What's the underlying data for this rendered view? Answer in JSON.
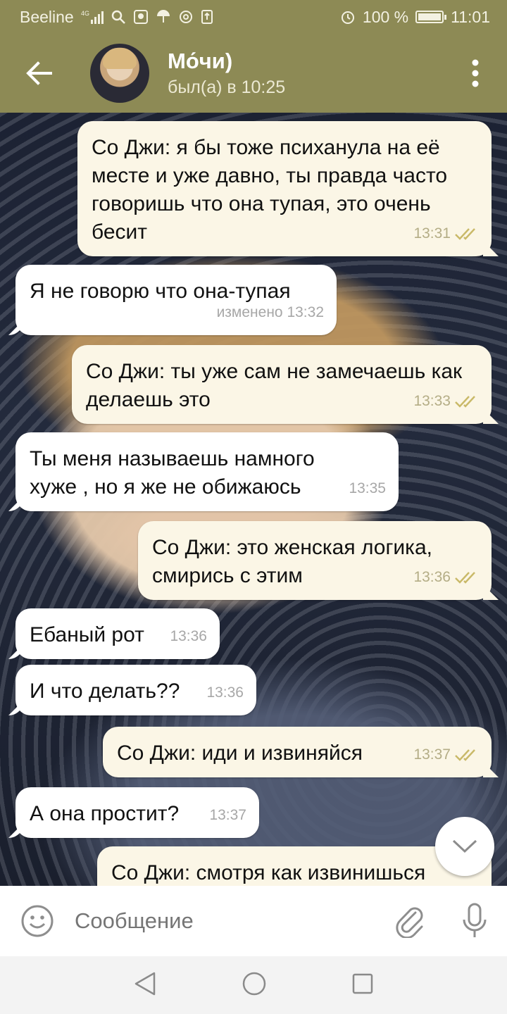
{
  "status_bar": {
    "carrier": "Beeline",
    "network": "4G",
    "battery": "100 %",
    "battery_level": 1.0,
    "time": "11:01"
  },
  "header": {
    "name": "Мо́чи)",
    "status": "был(а) в 10:25"
  },
  "messages": [
    {
      "direction": "out",
      "text": "Со Джи: я бы тоже психанула на её месте и уже давно, ты правда часто говоришь что она тупая, это очень бесит",
      "time": "13:31",
      "status": "read"
    },
    {
      "direction": "in",
      "text": "Я не говорю что она-тупая",
      "time": "изменено 13:32"
    },
    {
      "direction": "out",
      "text": "Со Джи: ты уже сам не замечаешь как делаешь это",
      "time": "13:33",
      "status": "read"
    },
    {
      "direction": "in",
      "text": "Ты меня называешь намного хуже , но я же не обижаюсь",
      "time": "13:35"
    },
    {
      "direction": "out",
      "text": "Со Джи: это женская логика, смирись с этим",
      "time": "13:36",
      "status": "read"
    },
    {
      "direction": "in",
      "text": "Ебаный рот",
      "time": "13:36"
    },
    {
      "direction": "in",
      "text": "И что делать??",
      "time": "13:36"
    },
    {
      "direction": "out",
      "text": "Со Джи: иди и извиняйся",
      "time": "13:37",
      "status": "read"
    },
    {
      "direction": "in",
      "text": "А она простит?",
      "time": "13:37"
    },
    {
      "direction": "out",
      "text": "Со Джи: смотря как извинишься",
      "time": "",
      "status": ""
    }
  ],
  "composer": {
    "placeholder": "Сообщение"
  },
  "colors": {
    "header_bg": "#8d8a55",
    "incoming_bubble": "#ffffff",
    "outgoing_bubble": "#fbf6e6",
    "read_check": "#c9b968"
  },
  "icons": {
    "back": "arrow-left-icon",
    "menu": "more-vertical-icon",
    "scroll": "chevron-down-icon",
    "emoji": "smile-icon",
    "attach": "paperclip-icon",
    "mic": "microphone-icon",
    "nav_back": "triangle-back-icon",
    "nav_home": "circle-home-icon",
    "nav_recent": "square-recent-icon"
  }
}
